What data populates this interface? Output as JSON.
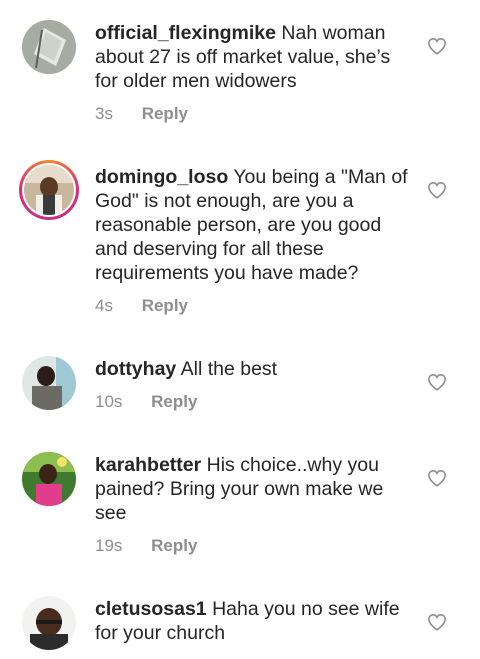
{
  "comments": [
    {
      "username": "official_flexingmike",
      "text": "Nah woman about 27 is off market value, she’s for older men widowers",
      "time": "3s",
      "reply": "Reply"
    },
    {
      "username": "domingo_loso",
      "text": "You being a \"Man of God\" is not enough, are you a reasonable person, are you good and deserving for all these requirements you have made?",
      "time": "4s",
      "reply": "Reply"
    },
    {
      "username": "dottyhay",
      "text": "All the best",
      "time": "10s",
      "reply": "Reply"
    },
    {
      "username": "karahbetter",
      "text": "His choice..why you pained? Bring your own make we see",
      "time": "19s",
      "reply": "Reply"
    },
    {
      "username": "cletusosas1",
      "text": "Haha you no see wife for your church",
      "time": "",
      "reply": ""
    }
  ],
  "icons": {
    "like": "heart-outline-icon"
  },
  "colors": {
    "text": "#262626",
    "muted": "#8e8e8e",
    "story_ring_start": "#f58529",
    "story_ring_end": "#dd2a7b"
  }
}
